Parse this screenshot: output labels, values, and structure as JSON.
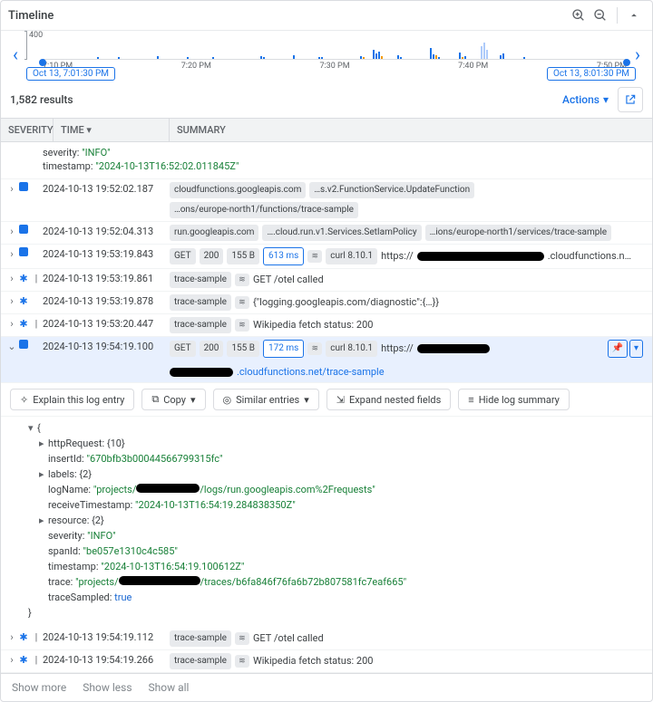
{
  "timeline": {
    "title": "Timeline",
    "ymax": "400",
    "ticks": [
      "7:10 PM",
      "7:20 PM",
      "7:30 PM",
      "7:40 PM",
      "7:50 PM"
    ],
    "start": "Oct 13, 7:01:30 PM",
    "end": "Oct 13, 8:01:30 PM"
  },
  "results": {
    "count": "1,582 results",
    "actions": "Actions"
  },
  "headers": {
    "sev": "SEVERITY",
    "time": "TIME",
    "sum": "SUMMARY"
  },
  "prelude": {
    "sev_key": "severity:",
    "sev_val": "\"INFO\"",
    "ts_key": "timestamp:",
    "ts_val": "\"2024-10-13T16:52:02.011845Z\""
  },
  "rows": [
    {
      "exp": "›",
      "sev": "info",
      "ts": "2024-10-13 19:52:02.187",
      "chips": [
        "cloudfunctions.googleapis.com",
        "…s.v2.FunctionService.UpdateFunction",
        "…ons/europe-north1/functions/trace-sample"
      ]
    },
    {
      "exp": "›",
      "sev": "info",
      "ts": "2024-10-13 19:52:04.313",
      "chips": [
        "run.googleapis.com",
        "….cloud.run.v1.Services.SetIamPolicy",
        "…ions/europe-north1/services/trace-sample"
      ]
    },
    {
      "exp": "›",
      "sev": "info",
      "ts": "2024-10-13 19:53:19.843",
      "method": "GET",
      "status": "200",
      "size": "155 B",
      "lat": "613 ms",
      "tr": true,
      "curl": "curl 8.10.1",
      "url_pre": "https://",
      "url_suf": ".cloudfunctions.n…"
    },
    {
      "exp": "›",
      "sev": "star",
      "extra": "|",
      "ts": "2024-10-13 19:53:19.861",
      "chipsL": [
        "trace-sample"
      ],
      "tr": true,
      "msg": "GET /otel called"
    },
    {
      "exp": "›",
      "sev": "star",
      "ts": "2024-10-13 19:53:19.878",
      "chipsL": [
        "trace-sample"
      ],
      "tr": true,
      "msg": "{\"logging.googleapis.com/diagnostic\":{…}}"
    },
    {
      "exp": "›",
      "sev": "star",
      "extra": "|",
      "ts": "2024-10-13 19:53:20.447",
      "chipsL": [
        "trace-sample"
      ],
      "tr": true,
      "msg": "Wikipedia fetch status: 200"
    },
    {
      "exp": "⌄",
      "sev": "info",
      "sel": true,
      "ts": "2024-10-13 19:54:19.100",
      "method": "GET",
      "status": "200",
      "size": "155 B",
      "lat": "172 ms",
      "tr": true,
      "curl": "curl 8.10.1",
      "url_pre": "https://",
      "line2": ".cloudfunctions.net/trace-sample",
      "pin": true
    },
    {
      "footer_rows": true
    }
  ],
  "actionsRow": {
    "explain": "Explain this log entry",
    "copy": "Copy",
    "similar": "Similar entries",
    "expand": "Expand nested fields",
    "hide": "Hide log summary"
  },
  "json": {
    "httpRequest": "httpRequest: {10}",
    "insertId_k": "insertId:",
    "insertId_v": "\"670bfb3b00044566799315fc\"",
    "labels": "labels: {2}",
    "logName_k": "logName:",
    "logName_pre": "\"projects/",
    "logName_suf": "/logs/run.googleapis.com%2Frequests\"",
    "recvTs_k": "receiveTimestamp:",
    "recvTs_v": "\"2024-10-13T16:54:19.284838350Z\"",
    "resource": "resource: {2}",
    "severity_k": "severity:",
    "severity_v": "\"INFO\"",
    "spanId_k": "spanId:",
    "spanId_v": "\"be057e1310c4c585\"",
    "ts_k": "timestamp:",
    "ts_v": "\"2024-10-13T16:54:19.100612Z\"",
    "trace_k": "trace:",
    "trace_pre": "\"projects/",
    "trace_suf": "/traces/b6fa846f76fa6b72b807581fc7eaf665\"",
    "traceSampled_k": "traceSampled:",
    "traceSampled_v": "true"
  },
  "rows2": [
    {
      "exp": "›",
      "sev": "star",
      "extra": "|",
      "ts": "2024-10-13 19:54:19.112",
      "chipsL": [
        "trace-sample"
      ],
      "tr": true,
      "msg": "GET /otel called"
    },
    {
      "exp": "›",
      "sev": "star",
      "extra": "|",
      "ts": "2024-10-13 19:54:19.266",
      "chipsL": [
        "trace-sample"
      ],
      "tr": true,
      "msg": "Wikipedia fetch status: 200"
    }
  ],
  "footer": {
    "more": "Show more",
    "less": "Show less",
    "all": "Show all"
  }
}
